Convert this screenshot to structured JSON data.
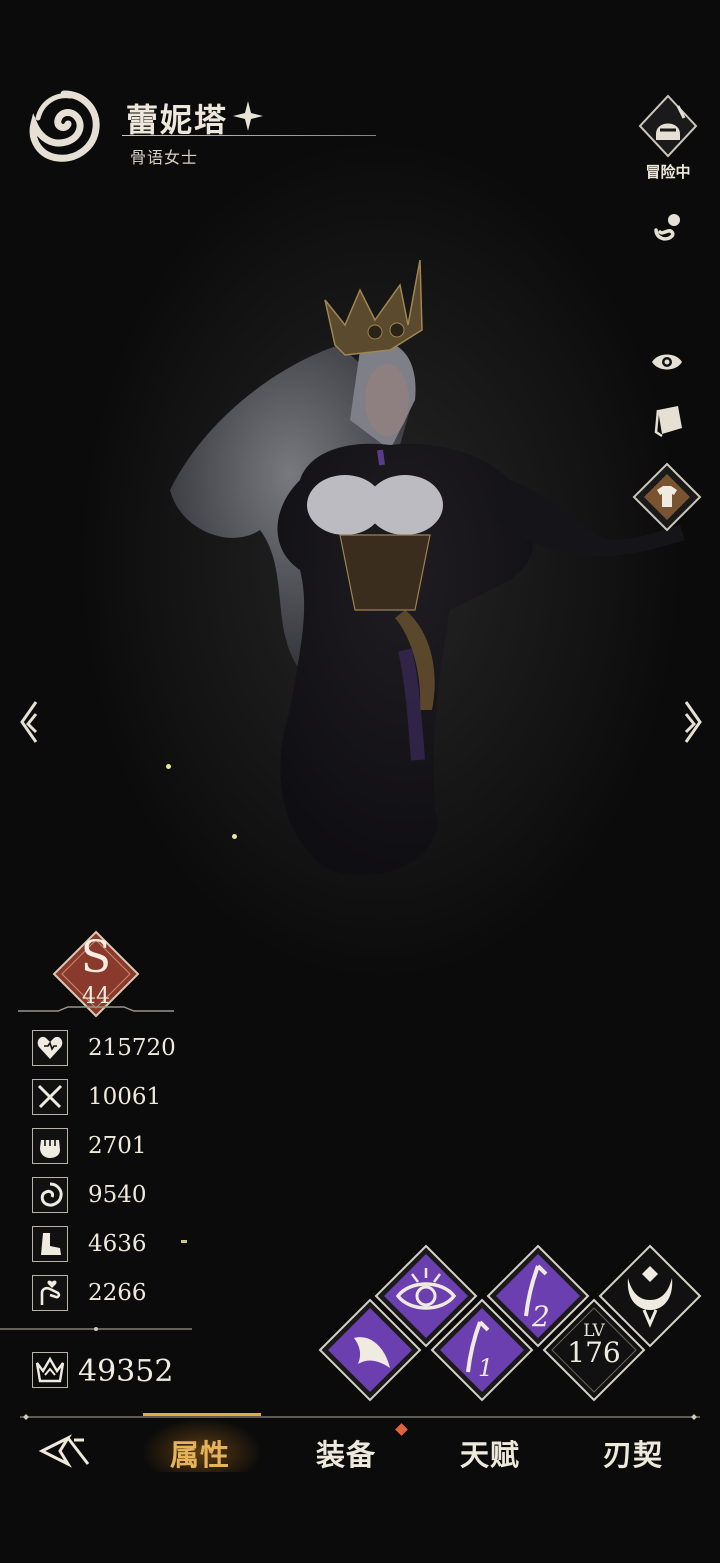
{
  "hero": {
    "name": "蕾妮塔",
    "title": "骨语女士"
  },
  "status": {
    "adventure_label": "冒险中"
  },
  "rank": {
    "letter": "S",
    "level": "44"
  },
  "stats": [
    {
      "icon": "heart-icon",
      "value": "215720"
    },
    {
      "icon": "swords-icon",
      "value": "10061"
    },
    {
      "icon": "fist-icon",
      "value": "2701"
    },
    {
      "icon": "swirl-icon",
      "value": "9540"
    },
    {
      "icon": "boot-icon",
      "value": "4636"
    },
    {
      "icon": "hand-heart-icon",
      "value": "2266"
    }
  ],
  "power": {
    "icon": "crown-emblem-icon",
    "value": "49352"
  },
  "skills": {
    "level_label": "LV",
    "level": "176",
    "skill2_num": "2",
    "skill1_num": "1"
  },
  "tabs": [
    {
      "label": "属性",
      "active": true
    },
    {
      "label": "装备",
      "active": false,
      "badge": true
    },
    {
      "label": "天赋",
      "active": false
    },
    {
      "label": "刃契",
      "active": false
    }
  ],
  "colors": {
    "accent_gold": "#e6b35a",
    "skill_purple": "#6c3fb0",
    "rank_red": "#8a3a2c",
    "badge_orange": "#e0633d",
    "outfit_brown": "#7a5430"
  }
}
